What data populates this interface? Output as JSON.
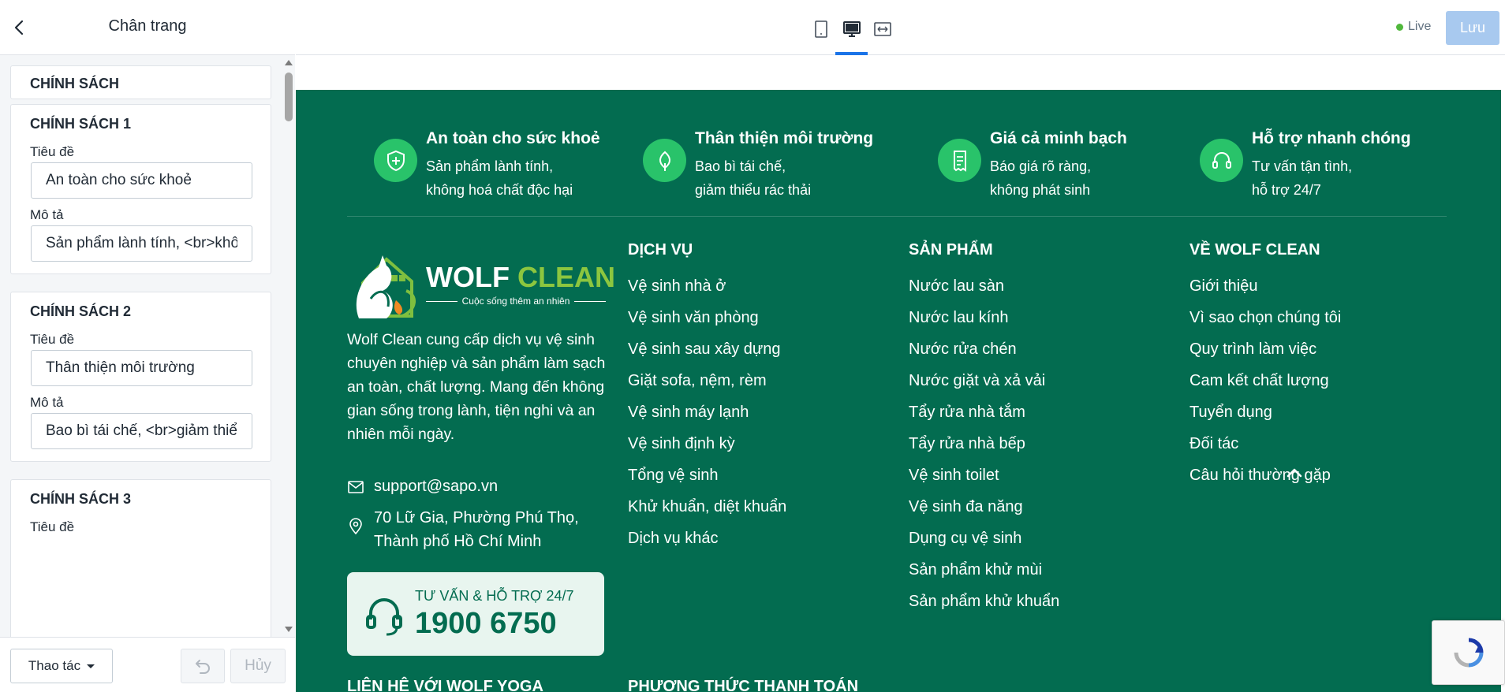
{
  "editor": {
    "title": "Chân trang",
    "section_label": "CHÍNH SÁCH",
    "title_field_label": "Tiêu đề",
    "desc_field_label": "Mô tả",
    "policies": [
      {
        "heading": "CHÍNH SÁCH 1",
        "title_value": "An toàn cho sức khoẻ",
        "desc_value": "Sản phẩm lành tính, <br>không hoá chất độc hại"
      },
      {
        "heading": "CHÍNH SÁCH 2",
        "title_value": "Thân thiện môi trường",
        "desc_value": "Bao bì tái chế, <br>giảm thiểu rác thải"
      },
      {
        "heading": "CHÍNH SÁCH 3",
        "title_value": "",
        "desc_value": ""
      }
    ],
    "actions_label": "Thao tác",
    "cancel_label": "Hủy"
  },
  "topbar": {
    "live_label": "Live",
    "save_label": "Lưu",
    "devices": [
      "mobile-icon",
      "desktop-icon",
      "fullwidth-icon"
    ],
    "active_device": "desktop"
  },
  "footer": {
    "colors": {
      "background": "#036c50",
      "accent": "#29c36a",
      "hotline_bg": "#e8f5ef"
    },
    "policies": [
      {
        "title": "An toàn cho sức khoẻ",
        "line1": "Sản phẩm lành tính,",
        "line2": "không hoá chất độc hại",
        "icon": "shield-icon"
      },
      {
        "title": "Thân thiện môi trường",
        "line1": "Bao bì tái chế,",
        "line2": "giảm thiểu rác thải",
        "icon": "leaf-icon"
      },
      {
        "title": "Giá cả minh bạch",
        "line1": "Báo giá rõ ràng,",
        "line2": "không phát sinh",
        "icon": "receipt-icon"
      },
      {
        "title": "Hỗ trợ nhanh chóng",
        "line1": "Tư vấn tận tình,",
        "line2": "hỗ trợ 24/7",
        "icon": "headset-icon"
      }
    ],
    "brand": {
      "name_part1": "WOLF",
      "name_part2": "CLEAN",
      "slogan": "Cuộc sống thêm an nhiên",
      "about": "Wolf Clean cung cấp dịch vụ vệ sinh chuyên nghiệp và sản phẩm làm sạch an toàn, chất lượng. Mang đến không gian sống trong lành, tiện nghi và an nhiên mỗi ngày."
    },
    "contact": {
      "email": "support@sapo.vn",
      "address_line1": "70 Lữ Gia, Phường Phú Thọ,",
      "address_line2": "Thành phố Hồ Chí Minh"
    },
    "hotline": {
      "label": "TƯ VẤN & HỖ TRỢ 24/7",
      "number": "1900 6750"
    },
    "columns": [
      {
        "title": "DỊCH VỤ",
        "items": [
          "Vệ sinh nhà ở",
          "Vệ sinh văn phòng",
          "Vệ sinh sau xây dựng",
          "Giặt sofa, nệm, rèm",
          "Vệ sinh máy lạnh",
          "Vệ sinh định kỳ",
          "Tổng vệ sinh",
          "Khử khuẩn, diệt khuẩn",
          "Dịch vụ khác"
        ]
      },
      {
        "title": "SẢN PHẨM",
        "items": [
          "Nước lau sàn",
          "Nước lau kính",
          "Nước rửa chén",
          "Nước giặt và xả vải",
          "Tẩy rửa nhà tắm",
          "Tẩy rửa nhà bếp",
          "Vệ sinh toilet",
          "Vệ sinh đa năng",
          "Dụng cụ vệ sinh",
          "Sản phẩm khử mùi",
          "Sản phẩm khử khuẩn"
        ]
      },
      {
        "title": "VỀ WOLF CLEAN",
        "items": [
          "Giới thiệu",
          "Vì sao chọn chúng tôi",
          "Quy trình làm việc",
          "Cam kết chất lượng",
          "Tuyển dụng",
          "Đối tác",
          "Câu hỏi thường gặp"
        ]
      }
    ],
    "bottom_headings": [
      "LIÊN HỆ VỚI WOLF YOGA",
      "PHƯƠNG THỨC THANH TOÁN"
    ]
  }
}
